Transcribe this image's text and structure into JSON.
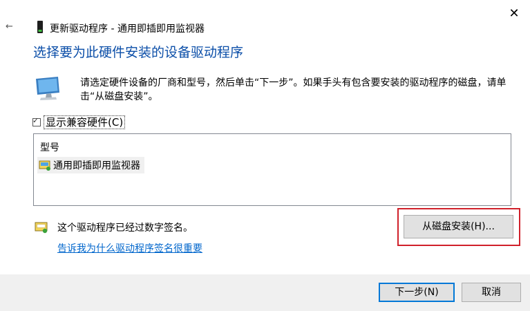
{
  "window": {
    "title": "更新驱动程序 - 通用即插即用监视器",
    "close_glyph": "✕",
    "back_glyph": "←"
  },
  "main": {
    "heading": "选择要为此硬件安装的设备驱动程序",
    "description": "请选定硬件设备的厂商和型号，然后单击“下一步”。如果手头有包含要安装的驱动程序的磁盘，请单击“从磁盘安装”。",
    "show_compatible": {
      "label": "显示兼容硬件(C)",
      "checked": true
    },
    "model_list": {
      "header": "型号",
      "items": [
        "通用即插即用监视器"
      ]
    },
    "signed_text": "这个驱动程序已经过数字签名。",
    "why_link": "告诉我为什么驱动程序签名很重要",
    "disk_button": "从磁盘安装(H)..."
  },
  "footer": {
    "next_button": "下一步(N)",
    "cancel_button": "取消"
  },
  "colors": {
    "heading": "#0b4ea8",
    "link": "#0066cc",
    "highlight": "#d0202a",
    "footer_bg": "#f0f0f0",
    "button_bg": "#e1e1e1"
  }
}
